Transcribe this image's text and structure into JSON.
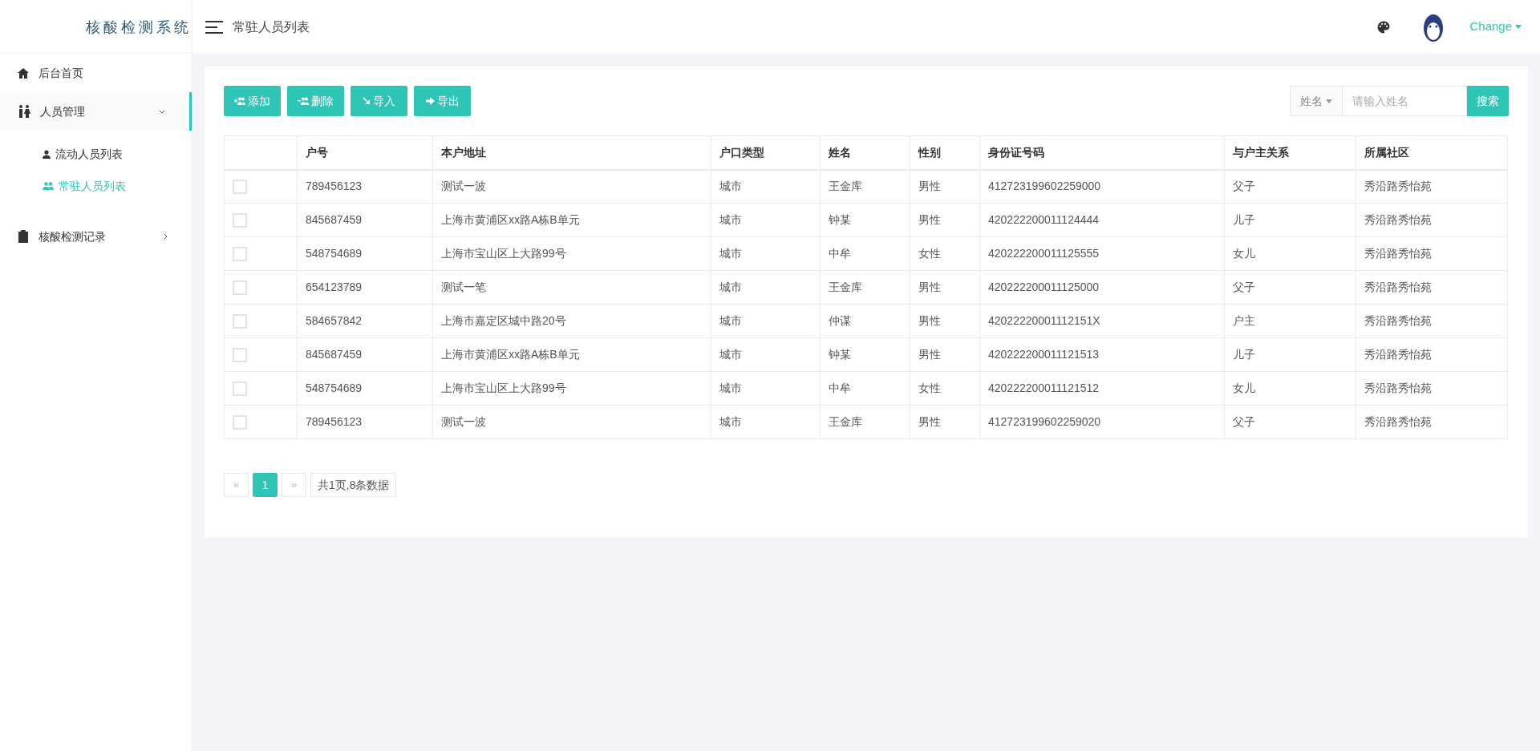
{
  "logo": "核酸检测系统",
  "header": {
    "title": "常驻人员列表",
    "user": "Change"
  },
  "sidebar": {
    "items": [
      {
        "label": "后台首页",
        "kind": "link",
        "selected": false
      },
      {
        "label": "人员管理",
        "kind": "group",
        "expanded": true,
        "selected": true,
        "children": [
          {
            "label": "流动人员列表",
            "selected": false
          },
          {
            "label": "常驻人员列表",
            "selected": true
          }
        ]
      },
      {
        "label": "核酸检测记录",
        "kind": "group",
        "expanded": false,
        "selected": false
      }
    ]
  },
  "toolbar": {
    "buttons": [
      {
        "label": "添加"
      },
      {
        "label": "删除"
      },
      {
        "label": "导入"
      },
      {
        "label": "导出"
      }
    ],
    "search": {
      "field_select": "姓名",
      "placeholder": "请输入姓名",
      "button": "搜索"
    }
  },
  "table": {
    "columns": [
      "户号",
      "本户地址",
      "户口类型",
      "姓名",
      "性别",
      "身份证号码",
      "与户主关系",
      "所属社区"
    ],
    "rows": [
      {
        "selected": false,
        "cells": [
          "789456123",
          "测试一波",
          "城市",
          "王金库",
          "男性",
          "412723199602259000",
          "父子",
          "秀沿路秀怡苑"
        ]
      },
      {
        "selected": false,
        "cells": [
          "845687459",
          "上海市黄浦区xx路A栋B单元",
          "城市",
          "钟某",
          "男性",
          "420222200011124444",
          "儿子",
          "秀沿路秀怡苑"
        ]
      },
      {
        "selected": false,
        "cells": [
          "548754689",
          "上海市宝山区上大路99号",
          "城市",
          "中牟",
          "女性",
          "420222200011125555",
          "女儿",
          "秀沿路秀怡苑"
        ]
      },
      {
        "selected": false,
        "cells": [
          "654123789",
          "测试一笔",
          "城市",
          "王金库",
          "男性",
          "420222200011125000",
          "父子",
          "秀沿路秀怡苑"
        ]
      },
      {
        "selected": false,
        "cells": [
          "584657842",
          "上海市嘉定区城中路20号",
          "城市",
          "仲谋",
          "男性",
          "42022220001112151X",
          "户主",
          "秀沿路秀怡苑"
        ]
      },
      {
        "selected": false,
        "cells": [
          "845687459",
          "上海市黄浦区xx路A栋B单元",
          "城市",
          "钟某",
          "男性",
          "420222200011121513",
          "儿子",
          "秀沿路秀怡苑"
        ]
      },
      {
        "selected": false,
        "cells": [
          "548754689",
          "上海市宝山区上大路99号",
          "城市",
          "中牟",
          "女性",
          "420222200011121512",
          "女儿",
          "秀沿路秀怡苑"
        ]
      },
      {
        "selected": false,
        "cells": [
          "789456123",
          "测试一波",
          "城市",
          "王金库",
          "男性",
          "412723199602259020",
          "父子",
          "秀沿路秀怡苑"
        ]
      }
    ]
  },
  "pagination": {
    "prev": "«",
    "pages": [
      {
        "label": "1",
        "selected": true
      }
    ],
    "next": "»",
    "summary": "共1页,8条数据"
  }
}
